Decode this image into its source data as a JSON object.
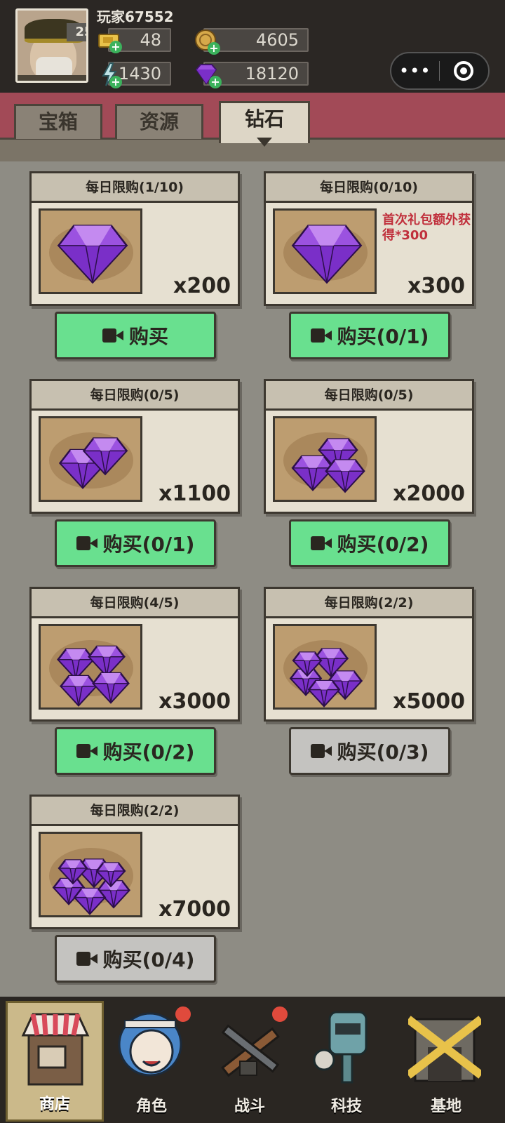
{
  "player": {
    "name": "玩家67552",
    "level": "25"
  },
  "resources": {
    "tickets": "48",
    "coins": "4605",
    "energy": "1430",
    "diamonds": "18120"
  },
  "capsule": {
    "more": "•••"
  },
  "tabs": [
    {
      "label": "宝箱",
      "active": false
    },
    {
      "label": "资源",
      "active": false
    },
    {
      "label": "钻石",
      "active": true
    }
  ],
  "cards": [
    {
      "header": "每日限购(1/10)",
      "qty": "x200",
      "note": "",
      "button": "购买",
      "button_state": "green",
      "gems": 1
    },
    {
      "header": "每日限购(0/10)",
      "qty": "x300",
      "note": "首次礼包额外获得*300",
      "button": "购买(0/1)",
      "button_state": "green",
      "gems": 1
    },
    {
      "header": "每日限购(0/5)",
      "qty": "x1100",
      "note": "",
      "button": "购买(0/1)",
      "button_state": "green",
      "gems": 2
    },
    {
      "header": "每日限购(0/5)",
      "qty": "x2000",
      "note": "",
      "button": "购买(0/2)",
      "button_state": "green",
      "gems": 3
    },
    {
      "header": "每日限购(4/5)",
      "qty": "x3000",
      "note": "",
      "button": "购买(0/2)",
      "button_state": "green",
      "gems": 4
    },
    {
      "header": "每日限购(2/2)",
      "qty": "x5000",
      "note": "",
      "button": "购买(0/3)",
      "button_state": "gray",
      "gems": 5
    },
    {
      "header": "每日限购(2/2)",
      "qty": "x7000",
      "note": "",
      "button": "购买(0/4)",
      "button_state": "gray",
      "gems": 6
    }
  ],
  "nav": [
    {
      "label": "商店",
      "icon": "shop-icon",
      "active": true,
      "badge": false
    },
    {
      "label": "角色",
      "icon": "character-icon",
      "active": false,
      "badge": true
    },
    {
      "label": "战斗",
      "icon": "battle-icon",
      "active": false,
      "badge": true
    },
    {
      "label": "科技",
      "icon": "tech-icon",
      "active": false,
      "badge": false
    },
    {
      "label": "基地",
      "icon": "base-icon",
      "active": false,
      "badge": false
    }
  ],
  "colors": {
    "button_green": "#69e08f",
    "button_gray": "#c4c3c0",
    "tab_bar": "#a24a57",
    "gem_purple": "#8a3ad0",
    "note_red": "#c0303c"
  }
}
